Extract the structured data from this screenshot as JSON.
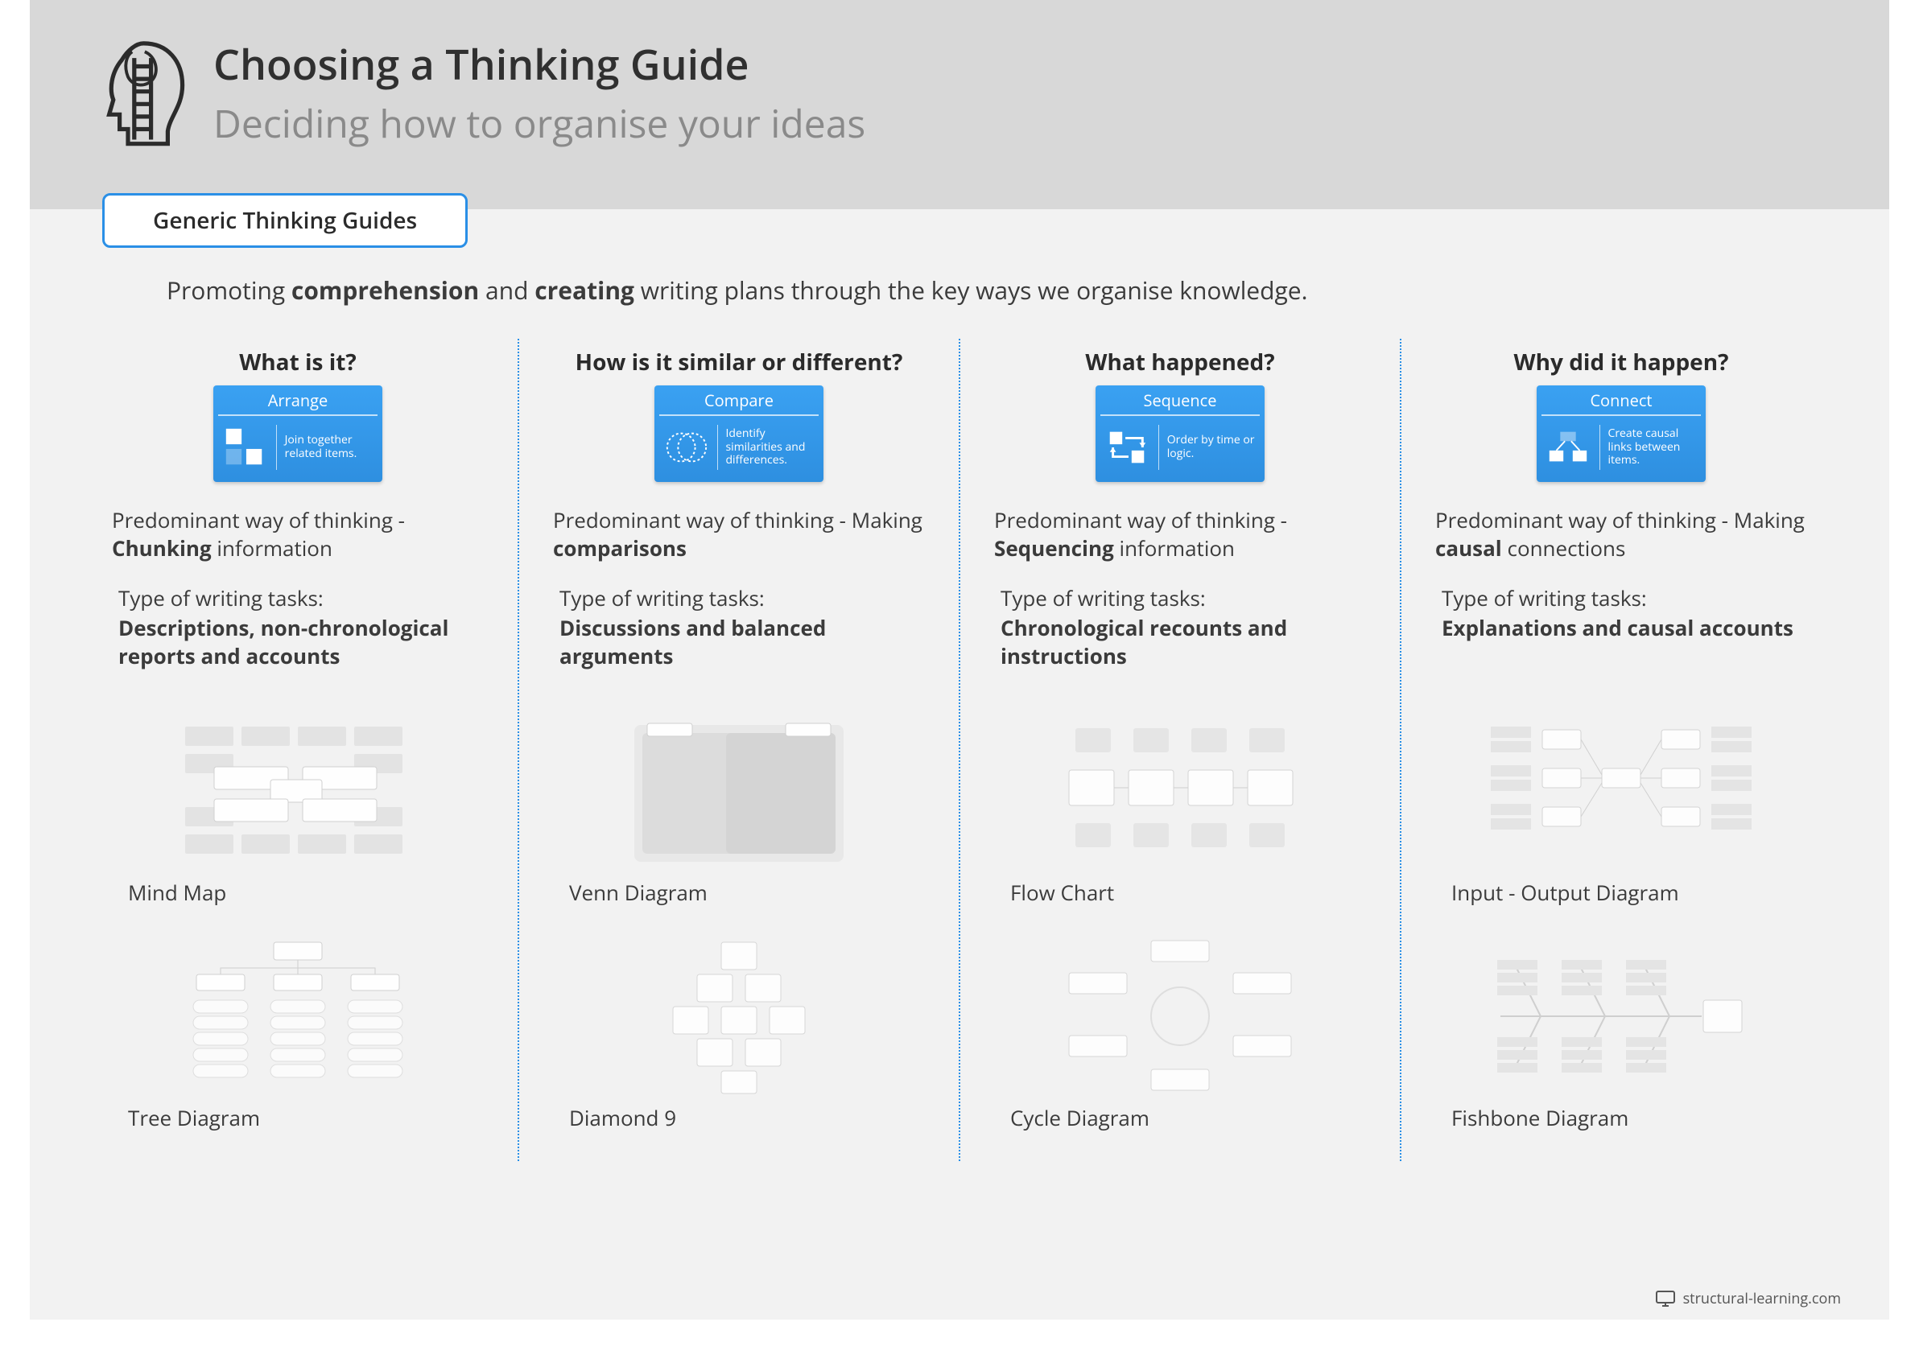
{
  "header": {
    "title": "Choosing a Thinking Guide",
    "subtitle": "Deciding how to organise your ideas",
    "tab_label": "Generic Thinking Guides"
  },
  "intro": {
    "pre": "Promoting ",
    "b1": "comprehension",
    "mid": " and ",
    "b2": "creating",
    "post": " writing plans through the key ways we organise knowledge."
  },
  "columns": [
    {
      "question": "What is it?",
      "card_title": "Arrange",
      "card_text": "Join together related items.",
      "think_pre": "Predominant way of thinking - ",
      "think_bold": "Chunking",
      "think_post": " information",
      "tasks_label": "Type of writing tasks:",
      "tasks": "Descriptions, non-chronological reports and accounts",
      "thumb1": "Mind Map",
      "thumb2": "Tree Diagram"
    },
    {
      "question": "How is it similar or different?",
      "card_title": "Compare",
      "card_text": "Identify similarities and differences.",
      "think_pre": "Predominant way of thinking - Making ",
      "think_bold": "comparisons",
      "think_post": "",
      "tasks_label": "Type of writing tasks:",
      "tasks": "Discussions and balanced arguments",
      "thumb1": "Venn Diagram",
      "thumb2": "Diamond 9"
    },
    {
      "question": "What happened?",
      "card_title": "Sequence",
      "card_text": "Order by time or logic.",
      "think_pre": "Predominant way of thinking - ",
      "think_bold": "Sequencing",
      "think_post": " information",
      "tasks_label": "Type of writing tasks:",
      "tasks": "Chronological recounts and instructions",
      "thumb1": "Flow Chart",
      "thumb2": "Cycle Diagram"
    },
    {
      "question": "Why did it happen?",
      "card_title": "Connect",
      "card_text": "Create causal links between items.",
      "think_pre": "Predominant way of thinking - Making ",
      "think_bold": "causal",
      "think_post": " connections",
      "tasks_label": "Type of writing tasks:",
      "tasks": "Explanations and causal accounts",
      "thumb1": "Input - Output Diagram",
      "thumb2": "Fishbone Diagram"
    }
  ],
  "footer": {
    "site": "structural-learning.com"
  }
}
